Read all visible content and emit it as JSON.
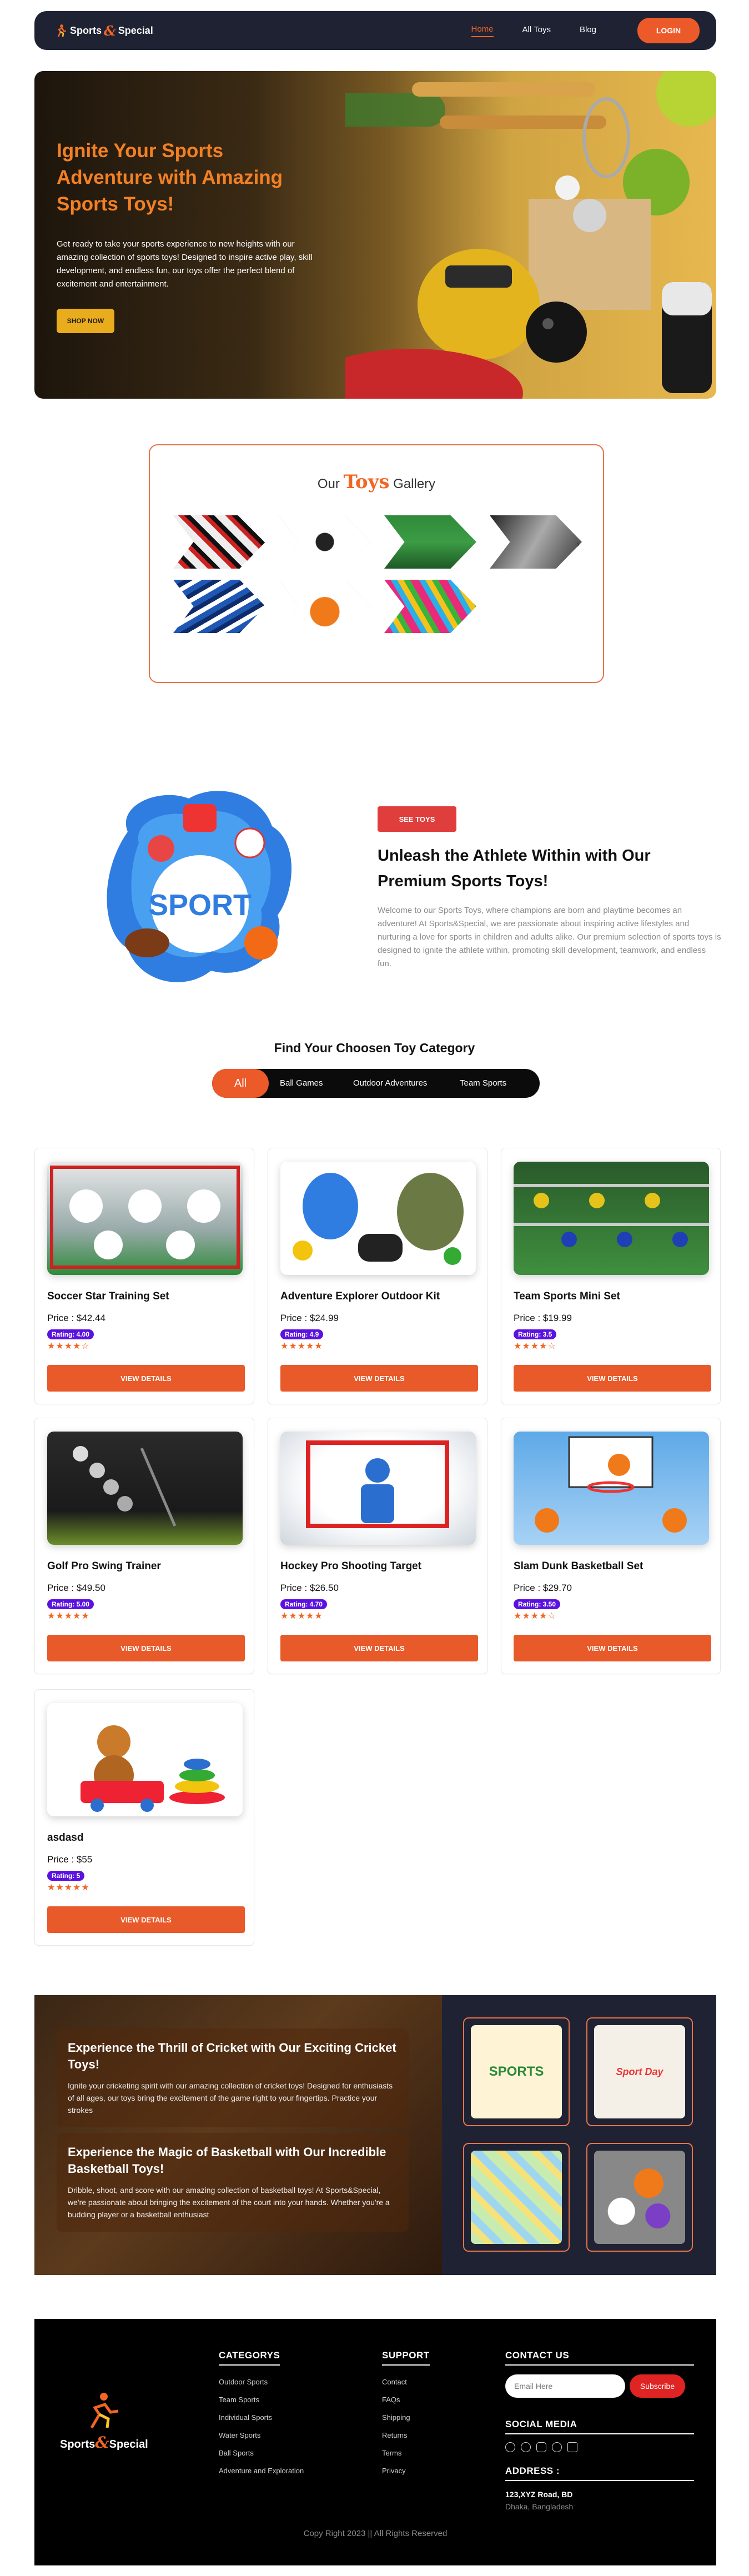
{
  "brand": {
    "name_left": "Sports",
    "amp": "&",
    "name_right": "Special",
    "accent": "#f26522"
  },
  "nav": {
    "items": [
      {
        "label": "Home",
        "active": true
      },
      {
        "label": "All Toys",
        "active": false
      },
      {
        "label": "Blog",
        "active": false
      }
    ],
    "login_label": "LOGIN"
  },
  "hero": {
    "title": "Ignite Your Sports Adventure with Amazing Sports Toys!",
    "body": "Get ready to take your sports experience to new heights with our amazing collection of sports toys! Designed to inspire active play, skill development, and endless fun, our toys offer the perfect blend of excitement and entertainment.",
    "cta": "SHOP NOW"
  },
  "gallery": {
    "prefix": "Our",
    "highlight": "Toys",
    "suffix": "Gallery",
    "next_icon": "›"
  },
  "about": {
    "badge": "SEE TOYS",
    "title": "Unleash the Athlete Within with Our Premium Sports Toys!",
    "body": "Welcome to our Sports Toys, where champions are born and playtime becomes an adventure! At Sports&Special, we are passionate about inspiring active lifestyles and nurturing a love for sports in children and adults alike. Our premium selection of sports toys is designed to ignite the athlete within, promoting skill development, teamwork, and endless fun.",
    "image_text": "SPORT"
  },
  "categories": {
    "title": "Find Your Choosen Toy Category",
    "tabs": [
      {
        "label": "All",
        "active": true
      },
      {
        "label": "Ball Games",
        "active": false
      },
      {
        "label": "Outdoor Adventures",
        "active": false
      },
      {
        "label": "Team Sports",
        "active": false
      }
    ]
  },
  "products": [
    {
      "name": "Soccer Star Training Set",
      "price": "Price : $42.44",
      "rating": "Rating: 4.00",
      "stars": "★★★★☆",
      "button": "VIEW DETAILS"
    },
    {
      "name": "Adventure Explorer Outdoor Kit",
      "price": "Price : $24.99",
      "rating": "Rating: 4.9",
      "stars": "★★★★★",
      "button": "VIEW DETAILS"
    },
    {
      "name": "Team Sports Mini Set",
      "price": "Price : $19.99",
      "rating": "Rating: 3.5",
      "stars": "★★★★☆",
      "button": "VIEW DETAILS"
    },
    {
      "name": "Golf Pro Swing Trainer",
      "price": "Price : $49.50",
      "rating": "Rating: 5.00",
      "stars": "★★★★★",
      "button": "VIEW DETAILS"
    },
    {
      "name": "Hockey Pro Shooting Target",
      "price": "Price : $26.50",
      "rating": "Rating: 4.70",
      "stars": "★★★★★",
      "button": "VIEW DETAILS"
    },
    {
      "name": "Slam Dunk Basketball Set",
      "price": "Price : $29.70",
      "rating": "Rating: 3.50",
      "stars": "★★★★☆",
      "button": "VIEW DETAILS"
    },
    {
      "name": "asdasd",
      "price": "Price : $55",
      "rating": "Rating: 5",
      "stars": "★★★★★",
      "button": "VIEW DETAILS"
    }
  ],
  "promo": {
    "cricket_title": "Experience the Thrill of Cricket with Our Exciting Cricket Toys!",
    "cricket_body": "Ignite your cricketing spirit with our amazing collection of cricket toys! Designed for enthusiasts of all ages, our toys bring the excitement of the game right to your fingertips. Practice your strokes",
    "basketball_title": "Experience the Magic of Basketball with Our Incredible Basketball Toys!",
    "basketball_body": "Dribble, shoot, and score with our amazing collection of basketball toys! At Sports&Special, we're passionate about bringing the excitement of the court into your hands. Whether you're a budding player or a basketball enthusiast",
    "tile1_text": "SPORTS",
    "tile2_text": "Sport Day"
  },
  "footer": {
    "categories_head": "CATEGORYS",
    "categories": [
      "Outdoor Sports",
      "Team Sports",
      "Individual Sports",
      "Water Sports",
      "Ball Sports",
      "Adventure and Exploration"
    ],
    "support_head": "SUPPORT",
    "support": [
      "Contact",
      "FAQs",
      "Shipping",
      "Returns",
      "Terms",
      "Privacy"
    ],
    "contact_head": "CONTACT US",
    "email_placeholder": "Email Here",
    "subscribe": "Subscribe",
    "social_head": "SOCIAL MEDIA",
    "social_icons": [
      "google-icon",
      "facebook-icon",
      "instagram-icon",
      "twitter-icon",
      "linkedin-icon"
    ],
    "address_head": "ADDRESS :",
    "address_line1": "123,XYZ Road, BD",
    "address_line2": "Dhaka, Bangladesh",
    "copyright": "Copy Right 2023 || All Rights Reserved"
  }
}
